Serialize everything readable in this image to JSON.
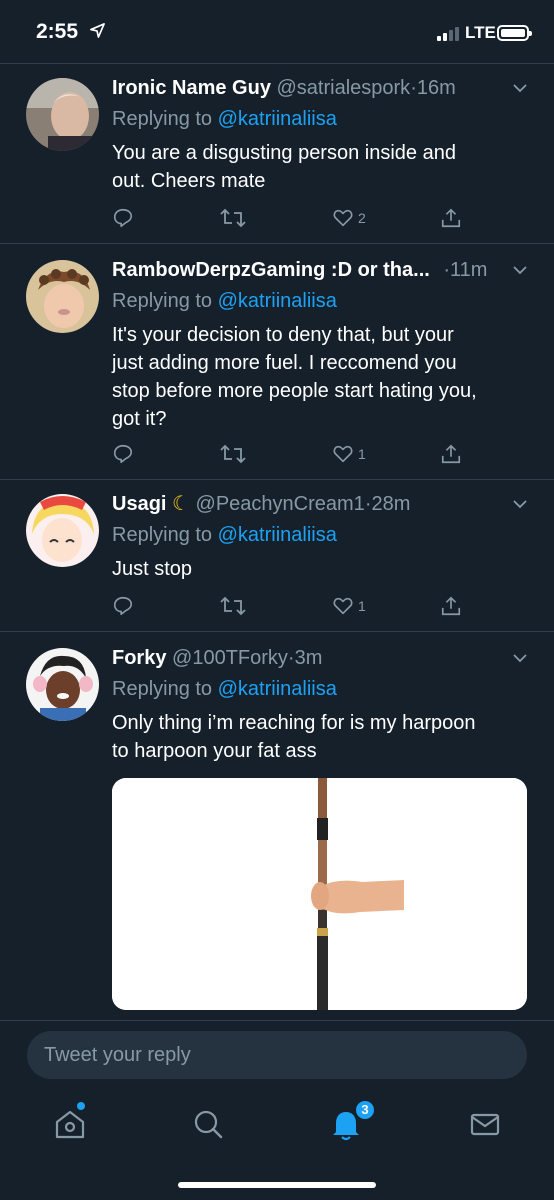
{
  "status_bar": {
    "time": "2:55",
    "network": "LTE",
    "icons": [
      "location-arrow-icon",
      "signal-icon",
      "battery-icon"
    ]
  },
  "tweets": [
    {
      "name": "Ironic Name Guy",
      "handle": "@satrialespork",
      "time": "16m",
      "replying_prefix": "Replying to",
      "replying_to": "@katriinaliisa",
      "lines": [
        "You are a disgusting person inside and",
        "out. Cheers mate"
      ],
      "like_count": "2"
    },
    {
      "name": "RambowDerpzGaming :D or tha...",
      "handle": "",
      "time": "11m",
      "replying_prefix": "Replying to",
      "replying_to": "@katriinaliisa",
      "lines": [
        "It's your decision to deny that, but your",
        "just adding more fuel. I reccomend you",
        "stop before more people start hating you,",
        "got it?"
      ],
      "like_count": "1"
    },
    {
      "name": "Usagi",
      "name_emoji": "crescent-moon-icon",
      "handle": "@PeachynCream1",
      "time": "28m",
      "replying_prefix": "Replying to",
      "replying_to": "@katriinaliisa",
      "lines": [
        "Just stop"
      ],
      "like_count": "1"
    },
    {
      "name": "Forky",
      "handle": "@100TForky",
      "time": "3m",
      "replying_prefix": "Replying to",
      "replying_to": "@katriinaliisa",
      "lines": [
        "Only thing i’m reaching for is my harpoon",
        "to harpoon your fat ass"
      ],
      "media": "image-of-hand-holding-harpoon-pole"
    }
  ],
  "reply": {
    "placeholder": "Tweet your reply"
  },
  "tabbar": {
    "tabs": [
      "home-icon",
      "search-icon",
      "notifications-icon",
      "messages-icon"
    ],
    "notifications_badge": "3"
  },
  "colors": {
    "background": "#15202b",
    "accent": "#1da1f2",
    "muted": "#8899a6",
    "divider": "#2f3d4c"
  }
}
